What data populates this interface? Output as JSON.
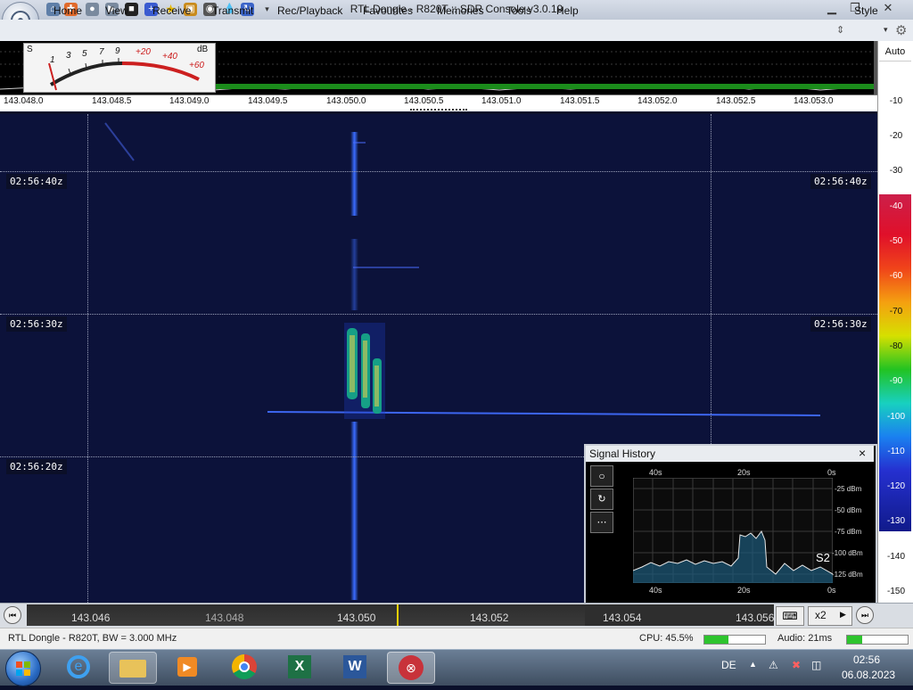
{
  "window": {
    "title": "RTL Dongle - R820T :: SDR Console v3.0.19",
    "controls": [
      "minimize",
      "maximize",
      "close"
    ],
    "quick_access": [
      "home-icon",
      "help-icon",
      "record-icon",
      "play-icon",
      "stop-icon",
      "add-icon",
      "star-icon",
      "lock-icon",
      "camera-icon",
      "drop-icon",
      "swirl-icon",
      "dropdown-icon"
    ]
  },
  "menu": {
    "items": [
      "Home",
      "View",
      "Receive",
      "Transmit",
      "Rec/Playback",
      "Favourites",
      "Memories",
      "Tools",
      "Help"
    ],
    "style_label": "Style"
  },
  "smeter": {
    "s_label": "S",
    "db_label": "dB",
    "scale": [
      "1",
      "3",
      "5",
      "7",
      "9",
      "+20",
      "+40",
      "+60"
    ]
  },
  "top_axis": {
    "ticks": [
      "143.048.0",
      "143.048.5",
      "143.049.0",
      "143.049.5",
      "143.050.0",
      "143.050.5",
      "143.051.0",
      "143.051.5",
      "143.052.0",
      "143.052.5",
      "143.053.0"
    ]
  },
  "right_scale": {
    "auto_label": "Auto",
    "ticks": [
      "-10",
      "-20",
      "-30",
      "-40",
      "-50",
      "-60",
      "-70",
      "-80",
      "-90",
      "-100",
      "-110",
      "-120",
      "-130",
      "-140",
      "-150"
    ]
  },
  "waterfall": {
    "times_left": [
      "02:56:40z",
      "02:56:30z",
      "02:56:20z"
    ],
    "times_right": [
      "02:56:40z",
      "02:56:30z"
    ]
  },
  "signal_history": {
    "title": "Signal History",
    "close": "×",
    "top_axis": [
      "40s",
      "20s",
      "0s"
    ],
    "bottom_axis": [
      "40s",
      "20s",
      "0s"
    ],
    "y_axis": [
      "-25 dBm",
      "-50 dBm",
      "-75 dBm",
      "-100 dBm",
      "-125 dBm"
    ],
    "s_reading": "S2"
  },
  "bottom_axis": {
    "ticks": [
      "143.046",
      "143.048",
      "143.050",
      "143.052",
      "143.054",
      "143.056"
    ],
    "zoom": "x2"
  },
  "status": {
    "device": "RTL Dongle - R820T, BW = 3.000 MHz",
    "cpu": "CPU: 45.5%",
    "cpu_level": 0.4,
    "audio": "Audio: 21ms",
    "audio_level": 0.25
  },
  "taskbar": {
    "language": "DE",
    "time": "02:56",
    "date": "06.08.2023",
    "apps": [
      "start-orb",
      "internet-explorer-icon",
      "file-explorer-icon",
      "media-player-icon",
      "chrome-icon",
      "excel-icon",
      "word-icon",
      "sdr-console-icon"
    ]
  }
}
